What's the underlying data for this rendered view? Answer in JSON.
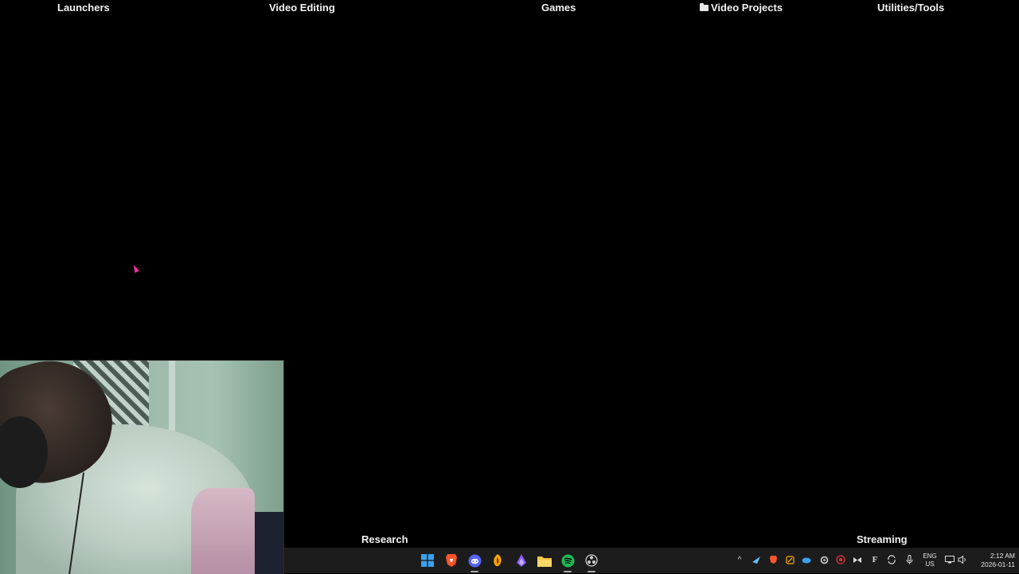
{
  "desktop": {
    "top_labels": [
      "Launchers",
      "Video Editing",
      "Games",
      "Video Projects",
      "Utilities/Tools"
    ],
    "bottom_labels": [
      "Research",
      "Streaming"
    ],
    "cursor_color": "#ff2ca8"
  },
  "webcam": {
    "icon": "webcam-feed"
  },
  "taskbar": {
    "apps": [
      {
        "name": "start",
        "icon": "windows-start-icon",
        "color": "#3aa0f0"
      },
      {
        "name": "brave",
        "icon": "brave-browser-icon",
        "color": "#fb542b"
      },
      {
        "name": "discord",
        "icon": "discord-icon",
        "color": "#5865f2"
      },
      {
        "name": "fl-studio",
        "icon": "fl-studio-icon",
        "color": "#f7a600"
      },
      {
        "name": "purple-app",
        "icon": "purple-app-icon",
        "color": "#8b5cf6"
      },
      {
        "name": "file-explorer",
        "icon": "folder-icon",
        "color": "#f6c343"
      },
      {
        "name": "spotify",
        "icon": "spotify-icon",
        "color": "#1db954"
      },
      {
        "name": "obs",
        "icon": "obs-icon",
        "color": "#d0d0d0"
      }
    ],
    "tray_icons": [
      "chevron-up-icon",
      "steam-icon",
      "brave-tray-icon",
      "tray-app-icon",
      "cloud-icon",
      "settings-tray-icon",
      "antivirus-icon",
      "nvidia-icon",
      "font-icon",
      "sync-icon",
      "microphone-icon",
      "network-icon",
      "volume-icon"
    ],
    "language": {
      "top": "ENG",
      "bottom": "US"
    },
    "clock": {
      "time": "2:12 AM",
      "date": "2026-01-11"
    }
  }
}
